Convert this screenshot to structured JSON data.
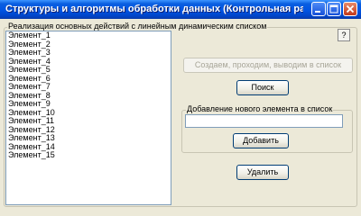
{
  "window": {
    "title": "Структуры и алгоритмы обработки данных (Контрольная ра..."
  },
  "main": {
    "group_label": "Реализация основных действий с линейным динамическим списком",
    "help_label": "?",
    "list_items": [
      "Элемент_1",
      "Элемент_2",
      "Элемент_3",
      "Элемент_4",
      "Элемент_5",
      "Элемент_6",
      "Элемент_7",
      "Элемент_8",
      "Элемент_9",
      "Элемент_10",
      "Элемент_11",
      "Элемент_12",
      "Элемент_13",
      "Элемент_14",
      "Элемент_15"
    ],
    "create_button_label": "Создаем, проходим, выводим в список",
    "search_button_label": "Поиск",
    "add_group_label": "Добавление нового элемента в список",
    "new_item_value": "",
    "add_button_label": "Добавить",
    "delete_button_label": "Удалить"
  }
}
